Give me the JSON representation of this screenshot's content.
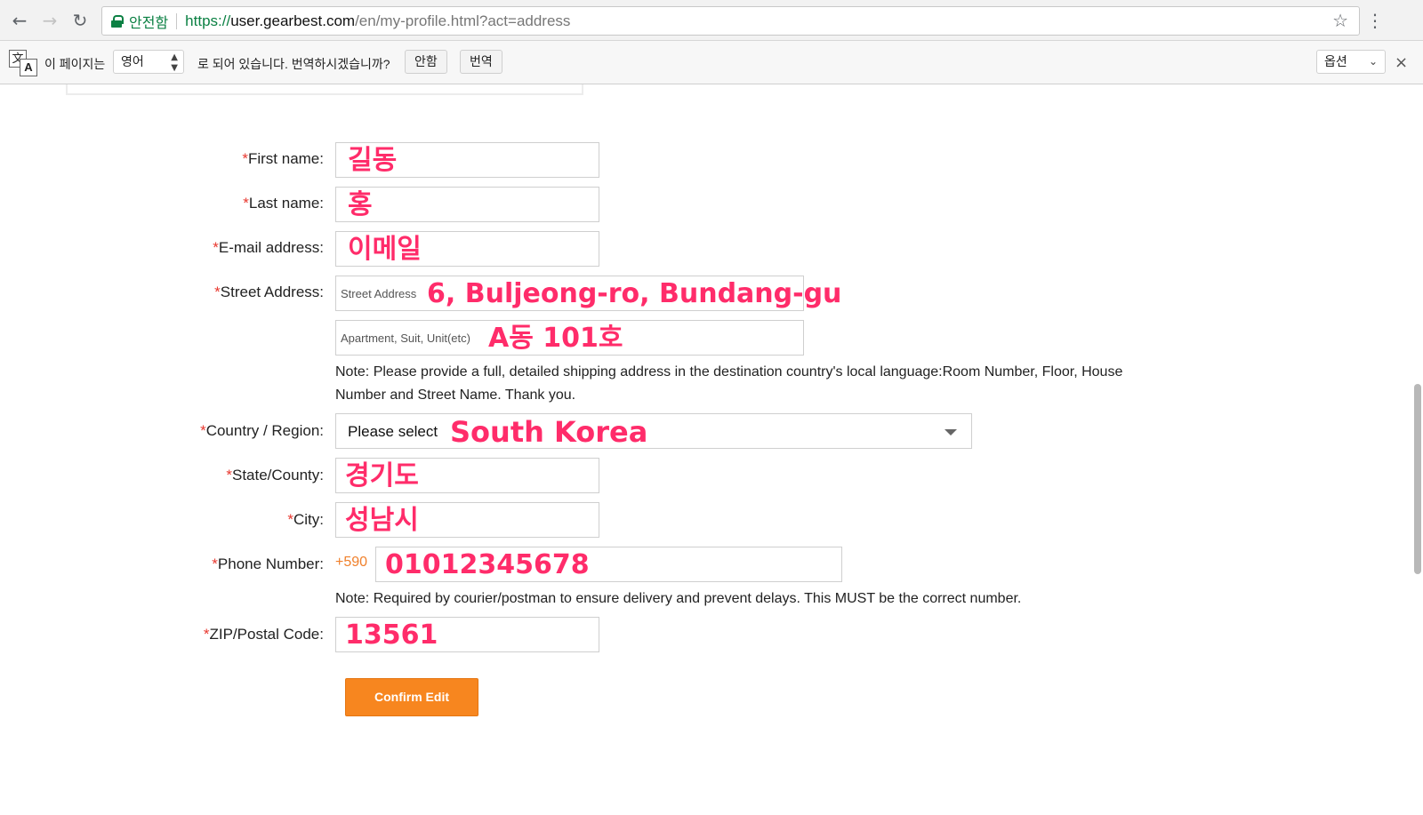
{
  "browser": {
    "secure_label": "안전함",
    "url_scheme": "https://",
    "url_host": "user.gearbest.com",
    "url_path": "/en/my-profile.html?act=address"
  },
  "translate_bar": {
    "prefix_text": "이 페이지는",
    "language": "영어",
    "suffix_text": "로 되어 있습니다. 번역하시겠습니까?",
    "decline_label": "안함",
    "translate_label": "번역",
    "options_label": "옵션"
  },
  "form": {
    "first_name": {
      "label": "First name:",
      "value": "길동"
    },
    "last_name": {
      "label": "Last name:",
      "value": "홍"
    },
    "email": {
      "label": "E-mail address:",
      "value": "이메일"
    },
    "street": {
      "label": "Street Address:",
      "placeholder": "Street Address",
      "value": "6, Buljeong-ro, Bundang-gu",
      "line2_placeholder": "Apartment, Suit, Unit(etc)",
      "line2_value": "A동 101호",
      "note_line1": "Note: Please provide a full, detailed shipping address in the destination country's local language:Room Number, Floor, House",
      "note_line2": "Number and Street Name. Thank you."
    },
    "country": {
      "label": "Country / Region:",
      "placeholder": "Please select",
      "value": "South Korea"
    },
    "state": {
      "label": "State/County:",
      "value": "경기도"
    },
    "city": {
      "label": "City:",
      "value": "성남시"
    },
    "phone": {
      "label": "Phone Number:",
      "prefix": "+590",
      "value": "01012345678",
      "note": "Note: Required by courier/postman to ensure delivery and prevent delays. This MUST be the correct number."
    },
    "zip": {
      "label": "ZIP/Postal Code:",
      "value": "13561"
    },
    "required_mark": "*",
    "confirm_label": "Confirm Edit"
  },
  "colors": {
    "required": "#e8382f",
    "annotation": "#ff2c6a",
    "button": "#f7861f",
    "prefix": "#f0802b",
    "secure": "#0b8043"
  }
}
